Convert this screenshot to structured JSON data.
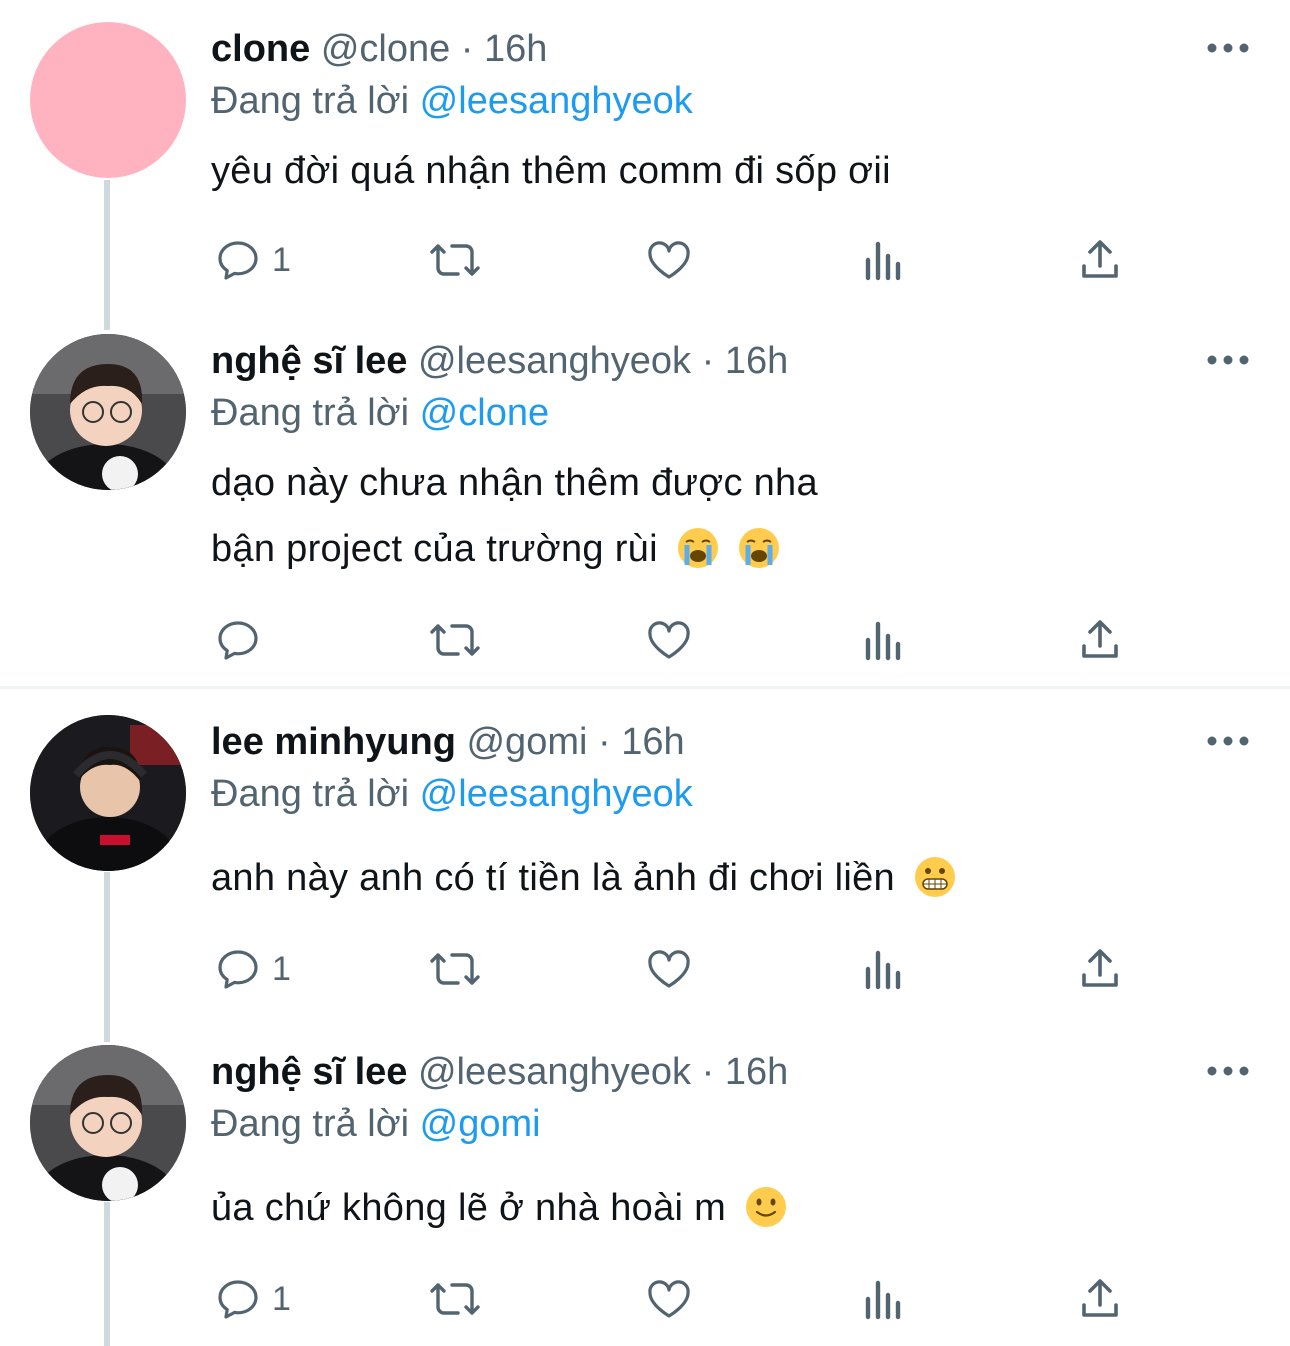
{
  "tweets": [
    {
      "name": "clone",
      "handle": "@clone",
      "dot": "·",
      "time": "16h",
      "reply_prefix": "Đang trả lời",
      "reply_to": "@leesanghyeok",
      "lines": [
        "yêu đời quá nhận thêm comm đi sốp ơii"
      ],
      "emojis": [],
      "reply_count": "1",
      "avatar": "pink-circle"
    },
    {
      "name": "nghệ sĩ lee",
      "handle": "@leesanghyeok",
      "dot": "·",
      "time": "16h",
      "reply_prefix": "Đang trả lời",
      "reply_to": "@clone",
      "lines": [
        "dạo này chưa nhận thêm được nha",
        "bận project của trường rùi"
      ],
      "emojis": [
        "loudly-crying-face",
        "loudly-crying-face"
      ],
      "reply_count": "",
      "avatar": "person-photo"
    },
    {
      "name": "lee minhyung",
      "handle": "@gomi",
      "dot": "·",
      "time": "16h",
      "reply_prefix": "Đang trả lời",
      "reply_to": "@leesanghyeok",
      "lines": [
        "anh này anh có tí tiền là ảnh đi chơi liền"
      ],
      "emojis": [
        "grimacing-face"
      ],
      "reply_count": "1",
      "avatar": "person-photo-dark"
    },
    {
      "name": "nghệ sĩ lee",
      "handle": "@leesanghyeok",
      "dot": "·",
      "time": "16h",
      "reply_prefix": "Đang trả lời",
      "reply_to": "@gomi",
      "lines": [
        "ủa chứ không lẽ ở nhà hoài m"
      ],
      "emojis": [
        "slightly-smiling-face"
      ],
      "reply_count": "1",
      "avatar": "person-photo"
    }
  ],
  "icons": {
    "reply": "speech-bubble-icon",
    "retweet": "retweet-icon",
    "like": "heart-icon",
    "views": "bar-chart-icon",
    "share": "share-icon",
    "more": "more-dots-icon"
  },
  "colors": {
    "link": "#1d9bf0",
    "secondary": "#536471",
    "avatar_pink": "#ffb3c1",
    "thread_line": "#cfd9de"
  }
}
